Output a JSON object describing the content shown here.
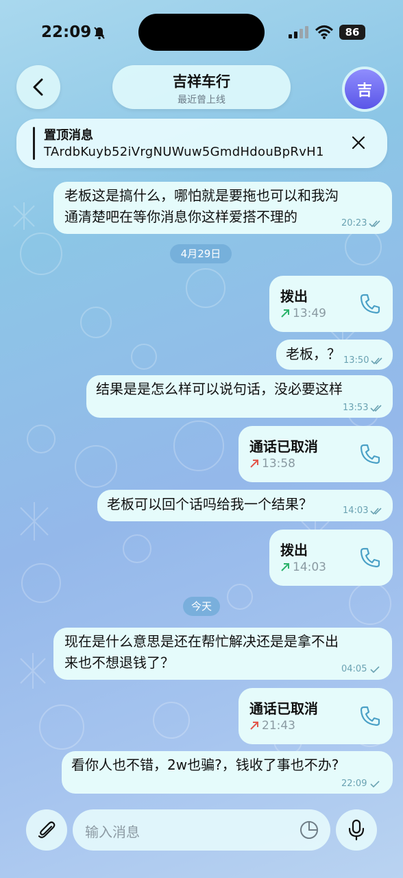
{
  "status_bar": {
    "time": "22:09",
    "battery": "86"
  },
  "header": {
    "title": "吉祥车行",
    "subtitle": "最近曾上线",
    "avatar_letter": "吉"
  },
  "pinned": {
    "title": "置顶消息",
    "text": "TArdbKuyb52iVrgNUWuw5GmdHdouBpRvH1"
  },
  "messages": [
    {
      "lines": [
        "老板这是搞什么，哪怕就是要拖也可以和我沟",
        "通清楚吧在等你消息你这样爱搭不理的"
      ],
      "time": "20:23"
    },
    {
      "date": "4月29日"
    },
    {
      "call": "拨出",
      "time": "13:49"
    },
    {
      "text": "老板，？",
      "time": "13:50"
    },
    {
      "text": "结果是是怎么样可以说句话，没必要这样",
      "time": "13:53"
    },
    {
      "call": "通话已取消",
      "time": "13:58"
    },
    {
      "text": "老板可以回个话吗给我一个结果？",
      "time": "14:03"
    },
    {
      "call": "拨出",
      "time": "14:03"
    },
    {
      "date": "今天"
    },
    {
      "lines": [
        "现在是什么意思是还在帮忙解决还是是拿不出",
        "来也不想退钱了？"
      ],
      "time": "04:05"
    },
    {
      "call": "通话已取消",
      "time": "21:43"
    },
    {
      "text": "看你人也不错，2w也骗?，钱收了事也不办?",
      "time": "22:09"
    }
  ],
  "input": {
    "placeholder": "输入消息"
  },
  "colors": {
    "bubble": "#e5fbfb",
    "outgoing_arrow": "#2bb36b",
    "cancelled_arrow": "#e2574c",
    "check": "#6aa2b2",
    "phone": "#4aa0c6"
  }
}
